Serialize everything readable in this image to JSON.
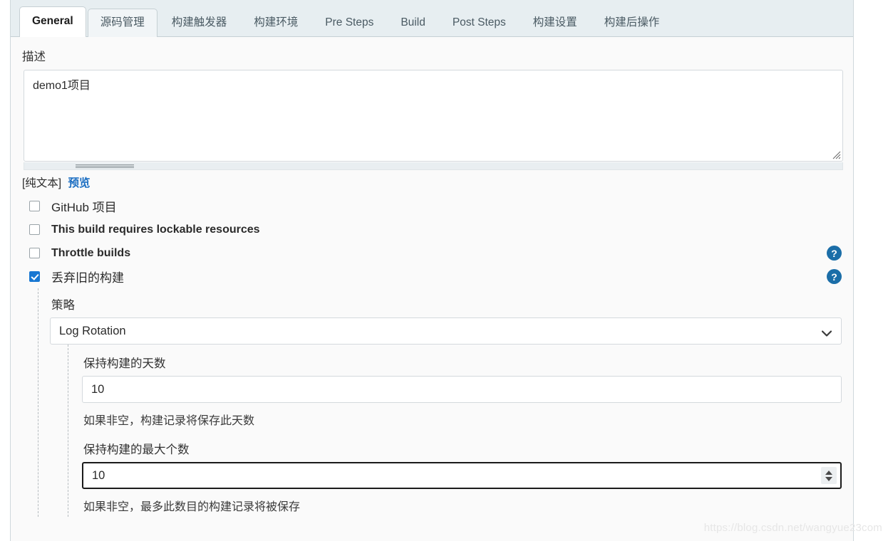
{
  "tabs": [
    {
      "label": "General",
      "state": "active"
    },
    {
      "label": "源码管理",
      "state": "hovered"
    },
    {
      "label": "构建触发器",
      "state": "normal"
    },
    {
      "label": "构建环境",
      "state": "normal"
    },
    {
      "label": "Pre Steps",
      "state": "normal"
    },
    {
      "label": "Build",
      "state": "normal"
    },
    {
      "label": "Post Steps",
      "state": "normal"
    },
    {
      "label": "构建设置",
      "state": "normal"
    },
    {
      "label": "构建后操作",
      "state": "normal"
    }
  ],
  "description": {
    "label": "描述",
    "value": "demo1项目",
    "placeholder": "",
    "markup_type": "[纯文本]",
    "preview_link": "预览"
  },
  "checkboxes": [
    {
      "label": "GitHub 项目",
      "checked": false,
      "has_help": false,
      "cjk": true
    },
    {
      "label": "This build requires lockable resources",
      "checked": false,
      "has_help": false,
      "cjk": false
    },
    {
      "label": "Throttle builds",
      "checked": false,
      "has_help": true,
      "cjk": false
    },
    {
      "label": "丢弃旧的构建",
      "checked": true,
      "has_help": true,
      "cjk": true
    }
  ],
  "discard_builds": {
    "strategy_label": "策略",
    "strategy_value": "Log Rotation",
    "strategy_options": [
      "Log Rotation"
    ],
    "days_to_keep": {
      "label": "保持构建的天数",
      "value": "10",
      "help": "如果非空，构建记录将保存此天数"
    },
    "max_builds_to_keep": {
      "label": "保持构建的最大个数",
      "value": "10",
      "help": "如果非空，最多此数目的构建记录将被保存"
    }
  },
  "icons": {
    "help": "?",
    "chevron_down": "chevron-down-icon",
    "spinner_up": "triangle-up-icon",
    "spinner_down": "triangle-down-icon",
    "resize_grip": "resize-grip-icon"
  },
  "watermark": "https://blog.csdn.net/wangyue23com"
}
